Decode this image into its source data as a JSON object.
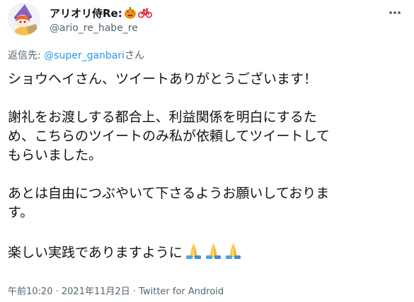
{
  "author": {
    "display_name": "アリオリ侍Re:",
    "name_emojis": [
      "jack-o-lantern-icon",
      "bicycle-icon"
    ],
    "handle": "@ario_re_habe_re"
  },
  "reply": {
    "prefix": "返信先: ",
    "mention": "@super_ganbari",
    "suffix": "さん"
  },
  "body": {
    "lines": [
      "ショウヘイさん、ツイートありがとうございます！",
      "謝礼をお渡しする都合上、利益関係を明白にするた",
      "め、こちらのツイートのみ私が依頼してツイートして",
      "もらいました。",
      "あとは自由につぶやいて下さるようお願いしておりま",
      "す。",
      "楽しい実践でありますように"
    ],
    "end_emojis": [
      "folded-hands-icon",
      "folded-hands-icon",
      "folded-hands-icon"
    ]
  },
  "meta": {
    "time": "午前10:20",
    "separator": " · ",
    "date": "2021年11月2日",
    "source": "Twitter for Android"
  },
  "colors": {
    "text": "#0f1419",
    "secondary": "#536471",
    "link": "#1d9bf0"
  }
}
